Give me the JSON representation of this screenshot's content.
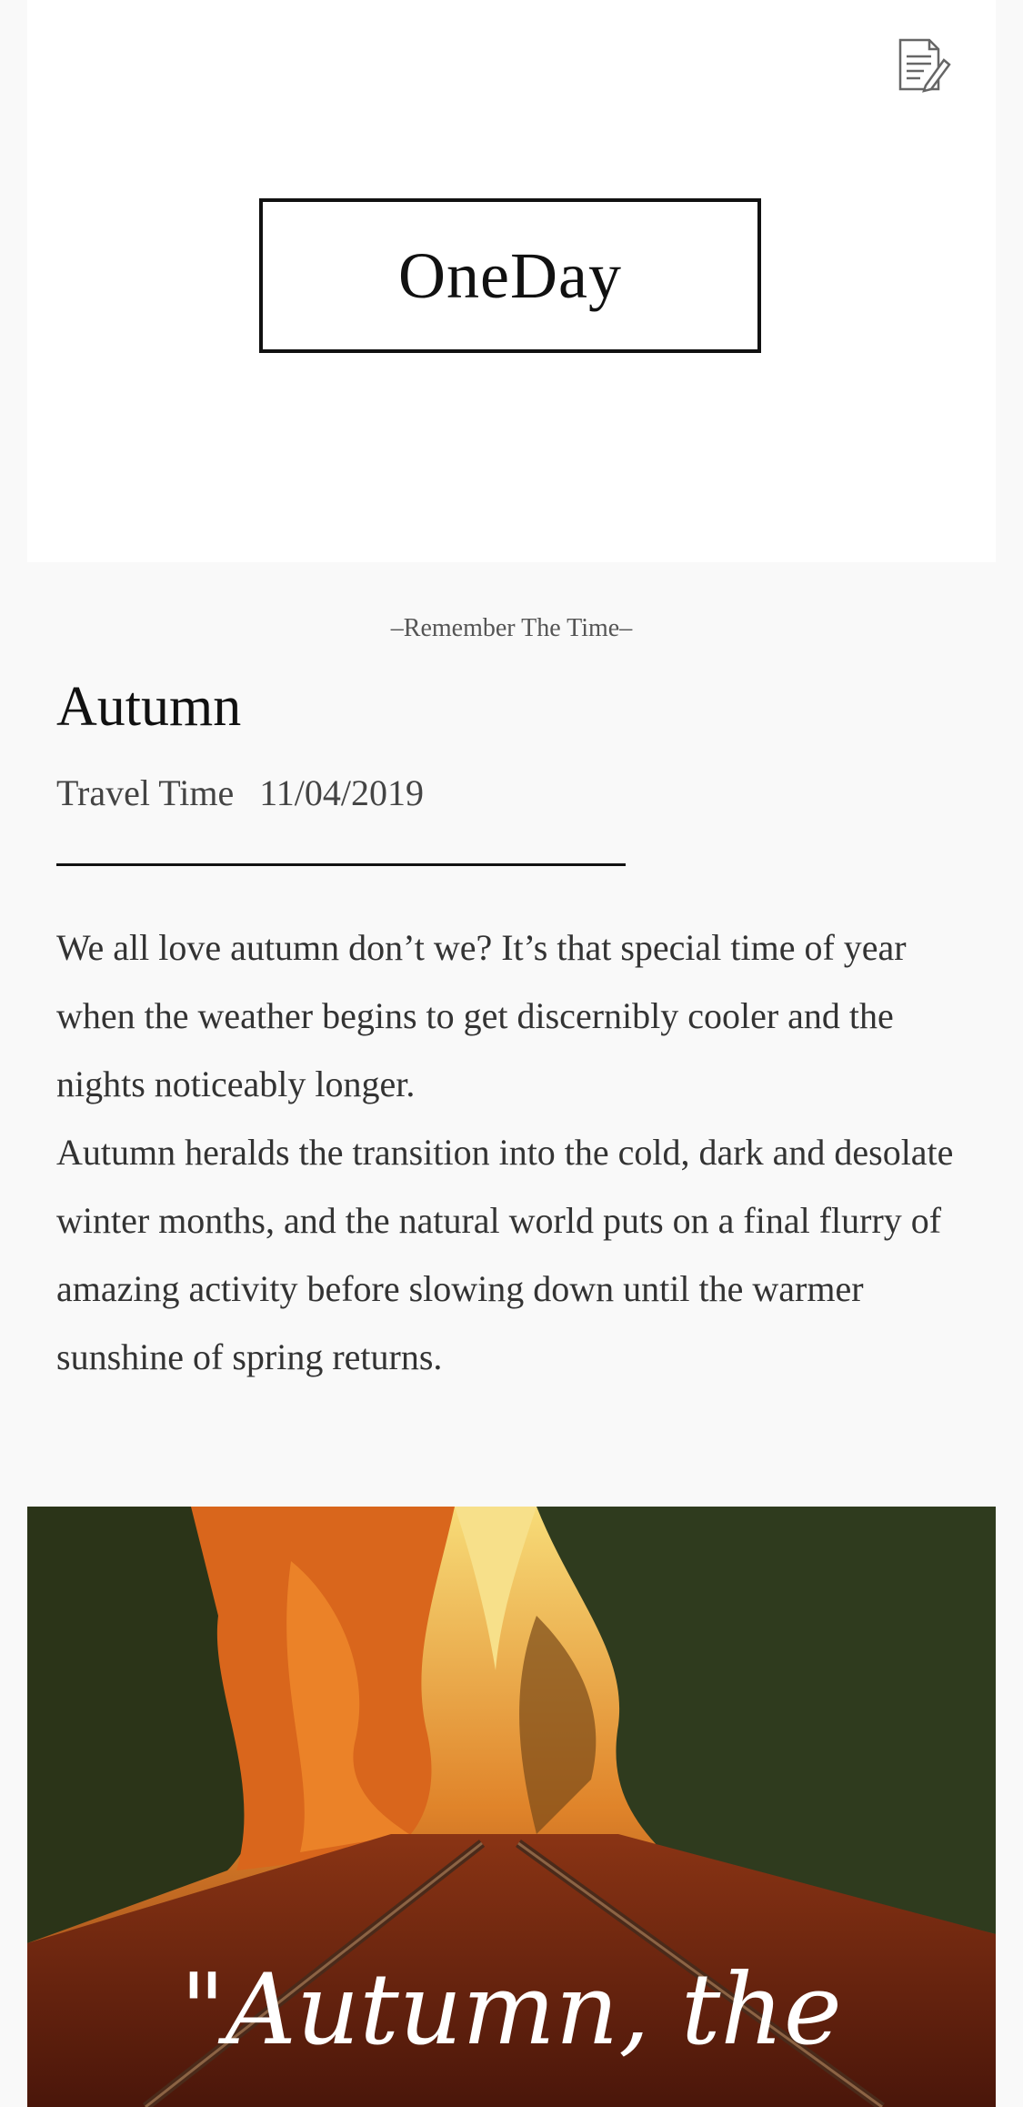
{
  "header": {
    "logo_text": "OneDay",
    "edit_icon": "edit-note-icon"
  },
  "tagline": "–Remember The Time–",
  "entry": {
    "title": "Autumn",
    "travel_label": "Travel Time",
    "travel_date": "11/04/2019",
    "paragraphs": [
      "We all love autumn don’t we? It’s that special time of year when the weather begins to get discernibly cooler and the nights noticeably longer.",
      "Autumn heralds the transition into the cold, dark and desolate winter months, and the natural world puts on a final flurry of amazing activity before slowing down until the warmer sunshine of spring returns."
    ]
  },
  "photo": {
    "overlay_text": "\"Autumn, the",
    "colors": {
      "sky": "#f3d36a",
      "foliage_orange": "#d9661c",
      "foliage_green": "#2f3b1e",
      "ground": "#6b2412"
    }
  }
}
